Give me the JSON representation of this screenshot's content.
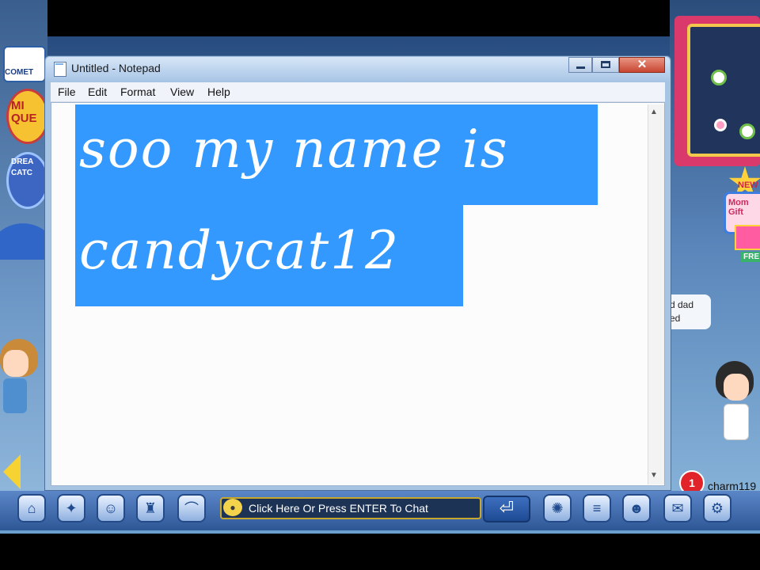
{
  "window": {
    "title": "Untitled - Notepad",
    "close_glyph": "✕"
  },
  "menu": {
    "items": [
      "File",
      "Edit",
      "Format",
      "View",
      "Help"
    ]
  },
  "editor": {
    "lines": [
      "soo my name is",
      "candycat12"
    ],
    "selected": true
  },
  "game": {
    "side_icons": {
      "comet": "COMET",
      "quest": "MI\nQUE",
      "dream": "DREA\nCATC"
    },
    "sign": {
      "new_label": "NEW",
      "gift_label": "Mom Gift",
      "free_label": "FRE"
    },
    "chat_bubble": "d dad\ned",
    "username_right": "charm119",
    "notification_count": "1",
    "chat_placeholder": "Click Here Or Press ENTER To Chat",
    "enter_glyph": "⏎"
  },
  "colors": {
    "selection": "#3399ff",
    "close_button": "#c74632",
    "toolbar": "#2e5796"
  }
}
